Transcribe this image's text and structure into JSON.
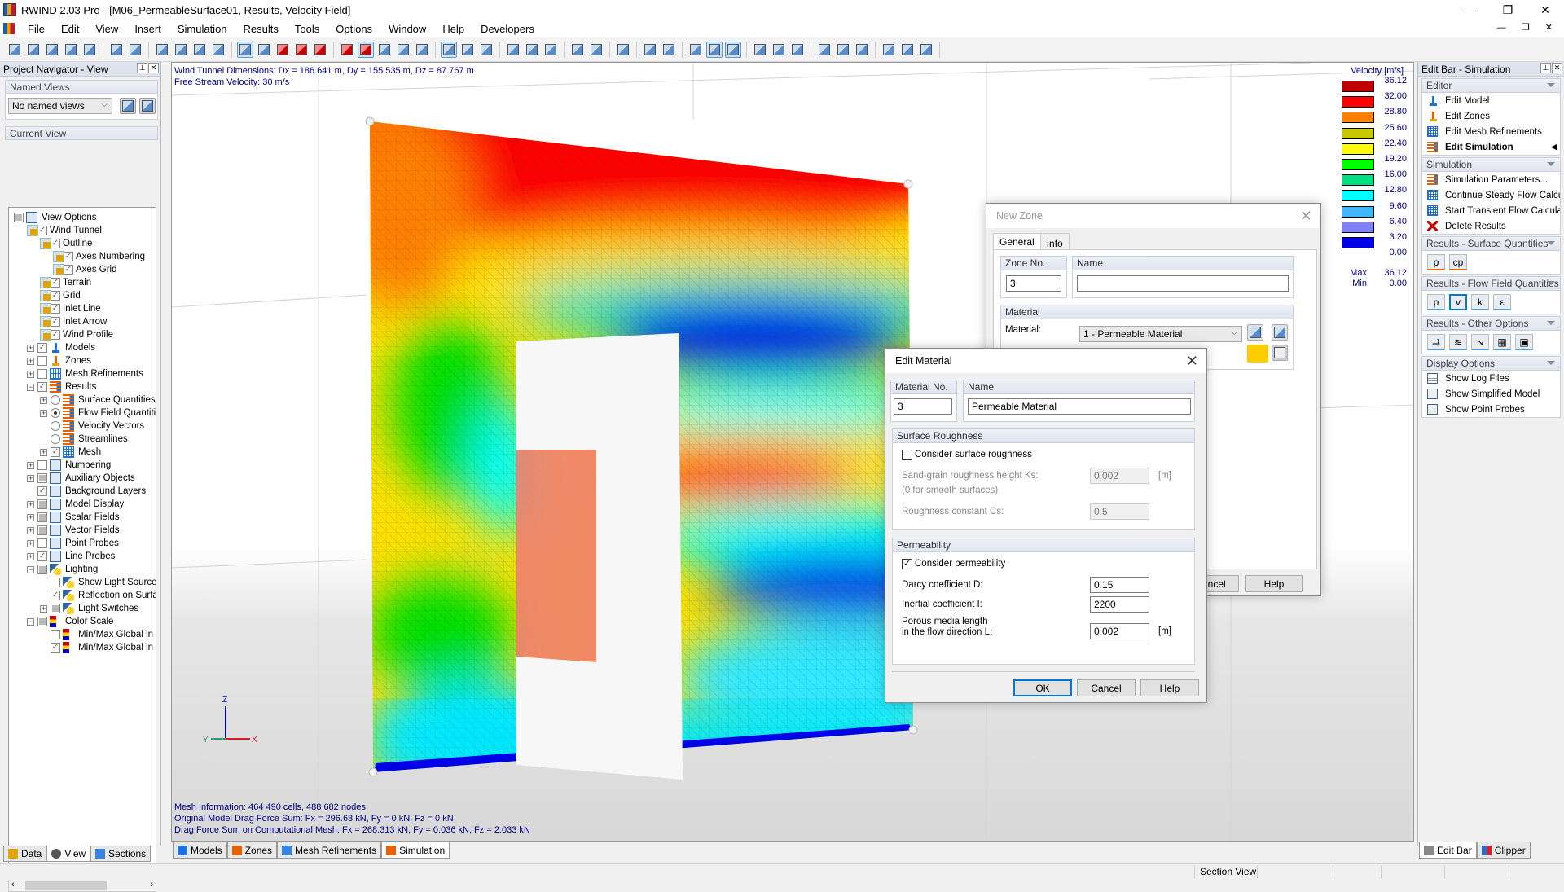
{
  "window": {
    "title": "RWIND 2.03 Pro - [M06_PermeableSurface01, Results, Velocity Field]",
    "controls": [
      "—",
      "❐",
      "✕"
    ]
  },
  "menu": [
    "File",
    "Edit",
    "View",
    "Insert",
    "Simulation",
    "Results",
    "Tools",
    "Options",
    "Window",
    "Help",
    "Developers"
  ],
  "left_panel": {
    "title": "Project Navigator - View",
    "named_views_header": "Named Views",
    "named_views_value": "No named views",
    "current_view_header": "Current View",
    "tree": [
      {
        "label": "View Options",
        "level": 0,
        "exp": "",
        "check": "partial",
        "icon": "generic"
      },
      {
        "label": "Wind Tunnel",
        "level": 1,
        "exp": "-",
        "check": "checked",
        "icon": "box"
      },
      {
        "label": "Outline",
        "level": 2,
        "exp": "-",
        "check": "checked",
        "icon": "box"
      },
      {
        "label": "Axes Numbering",
        "level": 3,
        "exp": "",
        "check": "checked",
        "icon": "box"
      },
      {
        "label": "Axes Grid",
        "level": 3,
        "exp": "",
        "check": "checked",
        "icon": "box"
      },
      {
        "label": "Terrain",
        "level": 2,
        "exp": "",
        "check": "checked",
        "icon": "box"
      },
      {
        "label": "Grid",
        "level": 2,
        "exp": "",
        "check": "checked",
        "icon": "box"
      },
      {
        "label": "Inlet Line",
        "level": 2,
        "exp": "",
        "check": "checked",
        "icon": "box"
      },
      {
        "label": "Inlet Arrow",
        "level": 2,
        "exp": "",
        "check": "checked",
        "icon": "box"
      },
      {
        "label": "Wind Profile",
        "level": 2,
        "exp": "",
        "check": "checked",
        "icon": "box"
      },
      {
        "label": "Models",
        "level": 1,
        "exp": "+",
        "check": "checked",
        "icon": "model"
      },
      {
        "label": "Zones",
        "level": 1,
        "exp": "+",
        "check": "unchecked",
        "icon": "zone"
      },
      {
        "label": "Mesh Refinements",
        "level": 1,
        "exp": "+",
        "check": "unchecked",
        "icon": "grid"
      },
      {
        "label": "Results",
        "level": 1,
        "exp": "-",
        "check": "checked",
        "icon": "results"
      },
      {
        "label": "Surface Quantities",
        "level": 2,
        "exp": "+",
        "check": "radio",
        "icon": "results"
      },
      {
        "label": "Flow Field Quantities",
        "level": 2,
        "exp": "+",
        "check": "radio-on",
        "icon": "results"
      },
      {
        "label": "Velocity Vectors",
        "level": 2,
        "exp": "",
        "check": "radio",
        "icon": "results"
      },
      {
        "label": "Streamlines",
        "level": 2,
        "exp": "",
        "check": "radio",
        "icon": "results"
      },
      {
        "label": "Mesh",
        "level": 2,
        "exp": "+",
        "check": "checked",
        "icon": "grid"
      },
      {
        "label": "Numbering",
        "level": 1,
        "exp": "+",
        "check": "unchecked",
        "icon": "generic"
      },
      {
        "label": "Auxiliary Objects",
        "level": 1,
        "exp": "+",
        "check": "partial",
        "icon": "generic"
      },
      {
        "label": "Background Layers",
        "level": 1,
        "exp": "",
        "check": "checked",
        "icon": "generic"
      },
      {
        "label": "Model Display",
        "level": 1,
        "exp": "+",
        "check": "partial",
        "icon": "generic"
      },
      {
        "label": "Scalar Fields",
        "level": 1,
        "exp": "+",
        "check": "partial",
        "icon": "generic"
      },
      {
        "label": "Vector Fields",
        "level": 1,
        "exp": "+",
        "check": "partial",
        "icon": "generic"
      },
      {
        "label": "Point Probes",
        "level": 1,
        "exp": "+",
        "check": "unchecked",
        "icon": "generic"
      },
      {
        "label": "Line Probes",
        "level": 1,
        "exp": "+",
        "check": "checked",
        "icon": "generic"
      },
      {
        "label": "Lighting",
        "level": 1,
        "exp": "-",
        "check": "partial",
        "icon": "light"
      },
      {
        "label": "Show Light Sources",
        "level": 2,
        "exp": "",
        "check": "unchecked",
        "icon": "light"
      },
      {
        "label": "Reflection on Surfaces",
        "level": 2,
        "exp": "",
        "check": "checked",
        "icon": "light"
      },
      {
        "label": "Light Switches",
        "level": 2,
        "exp": "+",
        "check": "partial",
        "icon": "light"
      },
      {
        "label": "Color Scale",
        "level": 1,
        "exp": "-",
        "check": "partial",
        "icon": "scale"
      },
      {
        "label": "Min/Max Global in Space",
        "level": 2,
        "exp": "",
        "check": "unchecked",
        "icon": "scale"
      },
      {
        "label": "Min/Max Global in Time",
        "level": 2,
        "exp": "",
        "check": "checked",
        "icon": "scale"
      }
    ],
    "tabs": [
      "Data",
      "View",
      "Sections"
    ]
  },
  "viewport": {
    "info_top": [
      "Wind Tunnel Dimensions: Dx = 186.641 m, Dy = 155.535 m, Dz = 87.767 m",
      "Free Stream Velocity: 30 m/s"
    ],
    "info_bottom": [
      "Mesh Information: 464 490 cells, 488 682 nodes",
      "Original Model Drag Force Sum: Fx = 296.63 kN, Fy = 0 kN, Fz = 0 kN",
      "Drag Force Sum on Computational Mesh: Fx = 268.313 kN, Fy = 0.036 kN, Fz = 2.033 kN"
    ],
    "axes": {
      "x": "X",
      "y": "Y",
      "z": "Z"
    },
    "legend": {
      "title": "Velocity [m/s]",
      "labels": [
        "36.12",
        "32.00",
        "28.80",
        "25.60",
        "22.40",
        "19.20",
        "16.00",
        "12.80",
        "9.60",
        "6.40",
        "3.20",
        "0.00"
      ],
      "colors": [
        "#bf0000",
        "#ff0000",
        "#ff8000",
        "#c8c800",
        "#ffff00",
        "#00ff00",
        "#00e080",
        "#00ffff",
        "#40b8ff",
        "#8080ff",
        "#0000e6"
      ],
      "max_label": "Max:",
      "max": "36.12",
      "min_label": "Min:",
      "min": "0.00"
    },
    "tabs": [
      "Models",
      "Zones",
      "Mesh Refinements",
      "Simulation"
    ]
  },
  "right_panel": {
    "title": "Edit Bar - Simulation",
    "editor": {
      "header": "Editor",
      "items": [
        "Edit Model",
        "Edit Zones",
        "Edit Mesh Refinements",
        "Edit Simulation"
      ]
    },
    "simulation": {
      "header": "Simulation",
      "items": [
        "Simulation Parameters...",
        "Continue Steady Flow Calculation...",
        "Start Transient Flow Calculation...",
        "Delete Results"
      ]
    },
    "surface": {
      "header": "Results - Surface Quantities",
      "buttons": [
        "p",
        "cp"
      ]
    },
    "flowfield": {
      "header": "Results - Flow Field Quantities",
      "buttons": [
        "p",
        "v",
        "k",
        "ε"
      ],
      "selected": "v"
    },
    "other": {
      "header": "Results - Other Options"
    },
    "display": {
      "header": "Display Options",
      "items": [
        "Show Log Files",
        "Show Simplified Model",
        "Show Point Probes"
      ]
    },
    "tabs": [
      "Edit Bar",
      "Clipper"
    ]
  },
  "new_zone": {
    "title": "New Zone",
    "tabs": [
      "General",
      "Info"
    ],
    "zone_no_label": "Zone No.",
    "zone_no": "3",
    "name_label": "Name",
    "name": "",
    "material_header": "Material",
    "material_label": "Material:",
    "material_value": "1 - Permeable Material",
    "material_color": "#ffcc00",
    "cancel": "Cancel",
    "help": "Help"
  },
  "edit_material": {
    "title": "Edit Material",
    "material_no_label": "Material No.",
    "material_no": "3",
    "name_label": "Name",
    "name": "Permeable Material",
    "roughness_header": "Surface Roughness",
    "consider_roughness": "Consider surface roughness",
    "consider_roughness_checked": false,
    "ks_label": "Sand-grain roughness height Ks:",
    "ks_sub": "(0 for smooth surfaces)",
    "ks": "0.002",
    "ks_unit": "[m]",
    "cs_label": "Roughness constant Cs:",
    "cs": "0.5",
    "perm_header": "Permeability",
    "consider_perm": "Consider permeability",
    "consider_perm_checked": true,
    "darcy_label": "Darcy coefficient D:",
    "darcy": "0.15",
    "inertial_label": "Inertial coefficient I:",
    "inertial": "2200",
    "porous_label_1": "Porous media length",
    "porous_label_2": "in the flow direction L:",
    "porous": "0.002",
    "porous_unit": "[m]",
    "ok": "OK",
    "cancel": "Cancel",
    "help": "Help"
  },
  "status": {
    "section_view": "Section View"
  }
}
